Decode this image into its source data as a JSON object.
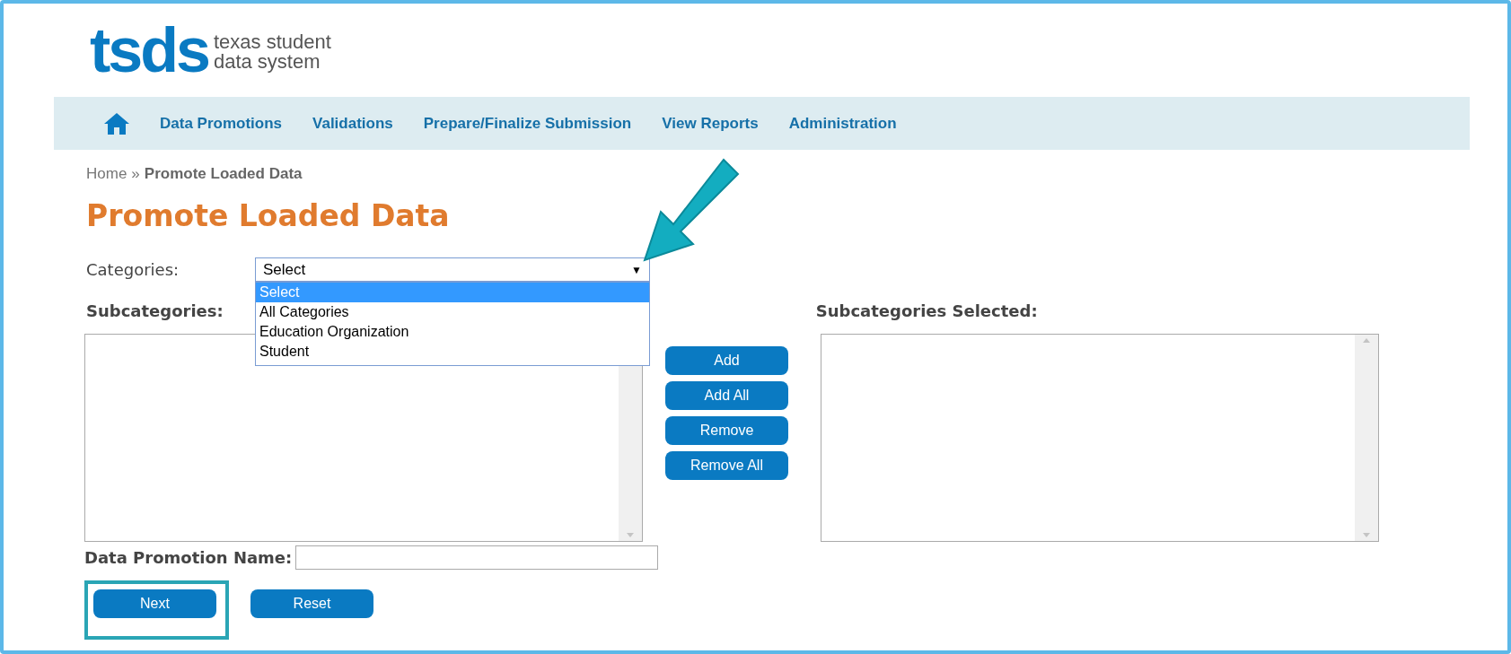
{
  "logo": {
    "mark": "tsds",
    "line_1": "texas student",
    "line_2": "data system"
  },
  "nav": {
    "items": [
      "Data Promotions",
      "Validations",
      "Prepare/Finalize Submission",
      "View Reports",
      "Administration"
    ]
  },
  "breadcrumb": {
    "home": "Home",
    "separator": "»",
    "current": "Promote Loaded Data"
  },
  "title": "Promote Loaded Data",
  "categories": {
    "label": "Categories:",
    "value": "Select",
    "caret": "▼",
    "expanded": true,
    "options": [
      {
        "label": "Select",
        "selected": true
      },
      {
        "label": "All Categories",
        "selected": false
      },
      {
        "label": "Education Organization",
        "selected": false
      },
      {
        "label": "Student",
        "selected": false
      }
    ]
  },
  "subcategories": {
    "label": "Subcategories:"
  },
  "selected_list": {
    "label": "Subcategories Selected:"
  },
  "transfer_buttons": [
    "Add",
    "Add All",
    "Remove",
    "Remove All"
  ],
  "name_field": {
    "label": "Data Promotion Name:"
  },
  "buttons": [
    {
      "label": "Next",
      "highlighted": true
    },
    {
      "label": "Reset",
      "highlighted": false
    }
  ]
}
